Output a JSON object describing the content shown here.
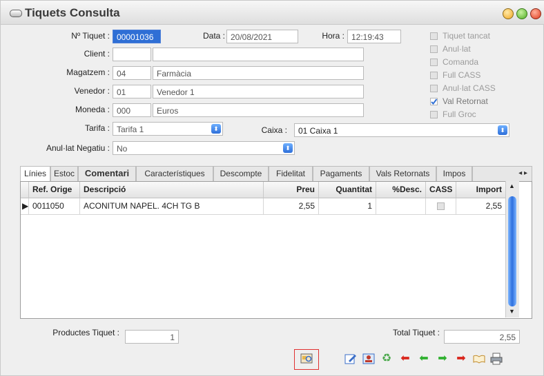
{
  "window": {
    "title": "Tiquets Consulta"
  },
  "form": {
    "ticket_label": "Nº Tiquet :",
    "ticket_value": "00001036",
    "data_label": "Data :",
    "data_value": "20/08/2021",
    "hora_label": "Hora :",
    "hora_value": "12:19:43",
    "client_label": "Client :",
    "client_code": "",
    "client_name": "",
    "magatzem_label": "Magatzem :",
    "magatzem_code": "04",
    "magatzem_name": "Farmàcia",
    "venedor_label": "Venedor :",
    "venedor_code": "01",
    "venedor_name": "Venedor 1",
    "moneda_label": "Moneda :",
    "moneda_code": "000",
    "moneda_name": "Euros",
    "tarifa_label": "Tarifa :",
    "tarifa_value": "Tarifa 1",
    "caixa_label": "Caixa :",
    "caixa_value": "01 Caixa 1",
    "anulat_negatiu_label": "Anul·lat Negatiu :",
    "anulat_negatiu_value": "No"
  },
  "checkboxes": [
    {
      "label": "Tiquet tancat",
      "checked": false
    },
    {
      "label": "Anul·lat",
      "checked": false
    },
    {
      "label": "Comanda",
      "checked": false
    },
    {
      "label": "Full CASS",
      "checked": false
    },
    {
      "label": "Anul·lat CASS",
      "checked": false
    },
    {
      "label": "Val Retornat",
      "checked": true
    },
    {
      "label": "Full Groc",
      "checked": false
    }
  ],
  "tabs": [
    "Línies",
    "Estoc",
    "Comentari",
    "Característiques",
    "Descompte",
    "Fidelitat",
    "Pagaments",
    "Vals Retornats",
    "Impos"
  ],
  "tab_scroll": "◂ ▸",
  "table": {
    "headers": [
      "Ref. Orige",
      "Descripció",
      "Preu",
      "Quantitat",
      "%Desc.",
      "CASS",
      "Import"
    ],
    "rows": [
      {
        "ref": "0011050",
        "desc": "ACONITUM NAPEL. 4CH TG B",
        "preu": "2,55",
        "quantitat": "1",
        "desc_pct": "",
        "cass": false,
        "import": "2,55"
      }
    ]
  },
  "footer": {
    "productes_label": "Productes Tiquet :",
    "productes_value": "1",
    "total_label": "Total Tiquet :",
    "total_value": "2,55"
  },
  "toolbar_icons": [
    "print-preview-icon",
    "edit-icon",
    "contact-card-icon",
    "refresh-icon",
    "first-arrow-icon",
    "previous-arrow-icon",
    "next-arrow-icon",
    "last-arrow-icon",
    "open-book-icon",
    "printer-icon"
  ],
  "colors": {
    "selection": "#2f6fd5",
    "arrow_red": "#d9261c",
    "arrow_green": "#2fb02f",
    "highlight_box": "#e03030"
  }
}
